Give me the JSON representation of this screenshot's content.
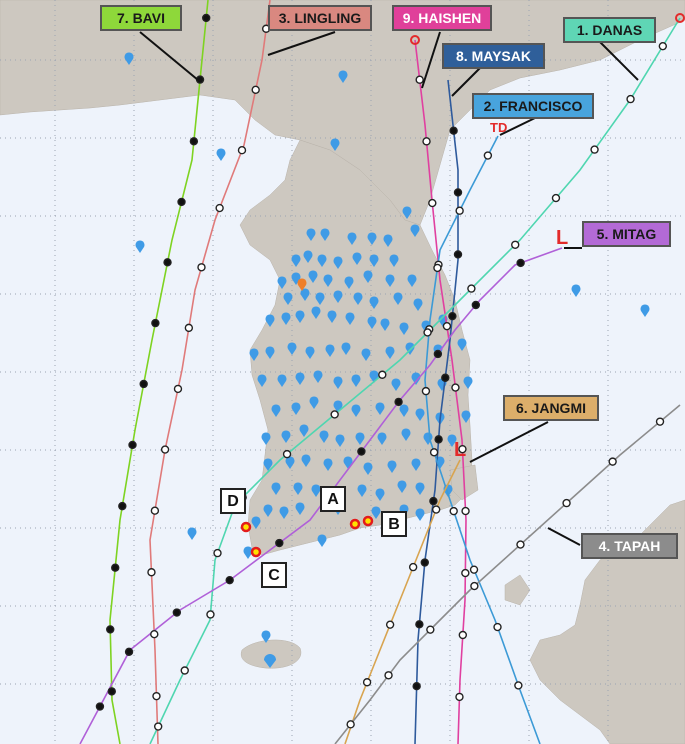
{
  "colors": {
    "sea": "#eef3fb",
    "land": "#cdc8c0",
    "grid": "#9aa3b2",
    "station": "#3f9be6",
    "station_alert": "#ef7f2a",
    "site": "#ef3b2c"
  },
  "typhoons": [
    {
      "id": "bavi",
      "label": "7. BAVI",
      "color": "#7ed321",
      "label_color": "#8ed83a",
      "text_color": "#1a1a1a"
    },
    {
      "id": "lingling",
      "label": "3. LINGLING",
      "color": "#e07a7a",
      "label_color": "#d98880",
      "text_color": "#1a1a1a"
    },
    {
      "id": "haishen",
      "label": "9. HAISHEN",
      "color": "#e040a0",
      "label_color": "#e0409a",
      "text_color": "#ffffff"
    },
    {
      "id": "maysak",
      "label": "8. MAYSAK",
      "color": "#2e5a9c",
      "label_color": "#2f5f9a",
      "text_color": "#ffffff"
    },
    {
      "id": "francisco",
      "label": "2. FRANCISCO",
      "color": "#3c9ad6",
      "label_color": "#48a4dd",
      "text_color": "#1a1a1a"
    },
    {
      "id": "danas",
      "label": "1. DANAS",
      "color": "#4fd6b0",
      "label_color": "#5fd6b5",
      "text_color": "#1a1a1a"
    },
    {
      "id": "mitag",
      "label": "5. MITAG",
      "color": "#b060d8",
      "label_color": "#b36ad6",
      "text_color": "#1a1a1a"
    },
    {
      "id": "jangmi",
      "label": "6. JANGMI",
      "color": "#d8a450",
      "label_color": "#dcae6a",
      "text_color": "#1a1a1a"
    },
    {
      "id": "tapah",
      "label": "4. TAPAH",
      "color": "#8c8c8c",
      "label_color": "#8c8c8c",
      "text_color": "#ffffff"
    }
  ],
  "sites": [
    "A",
    "B",
    "C",
    "D"
  ],
  "map_symbols": {
    "low": "L",
    "depression": "TD"
  }
}
